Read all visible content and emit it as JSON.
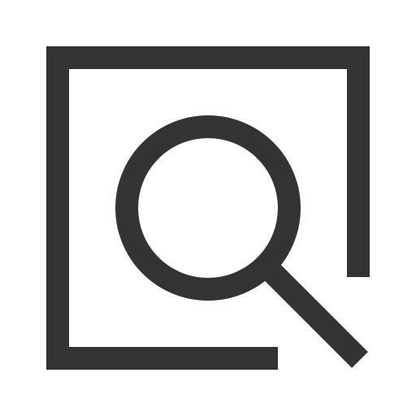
{
  "icon": {
    "name": "search-in-frame-icon",
    "color": "#333333",
    "background": "#ffffff"
  }
}
